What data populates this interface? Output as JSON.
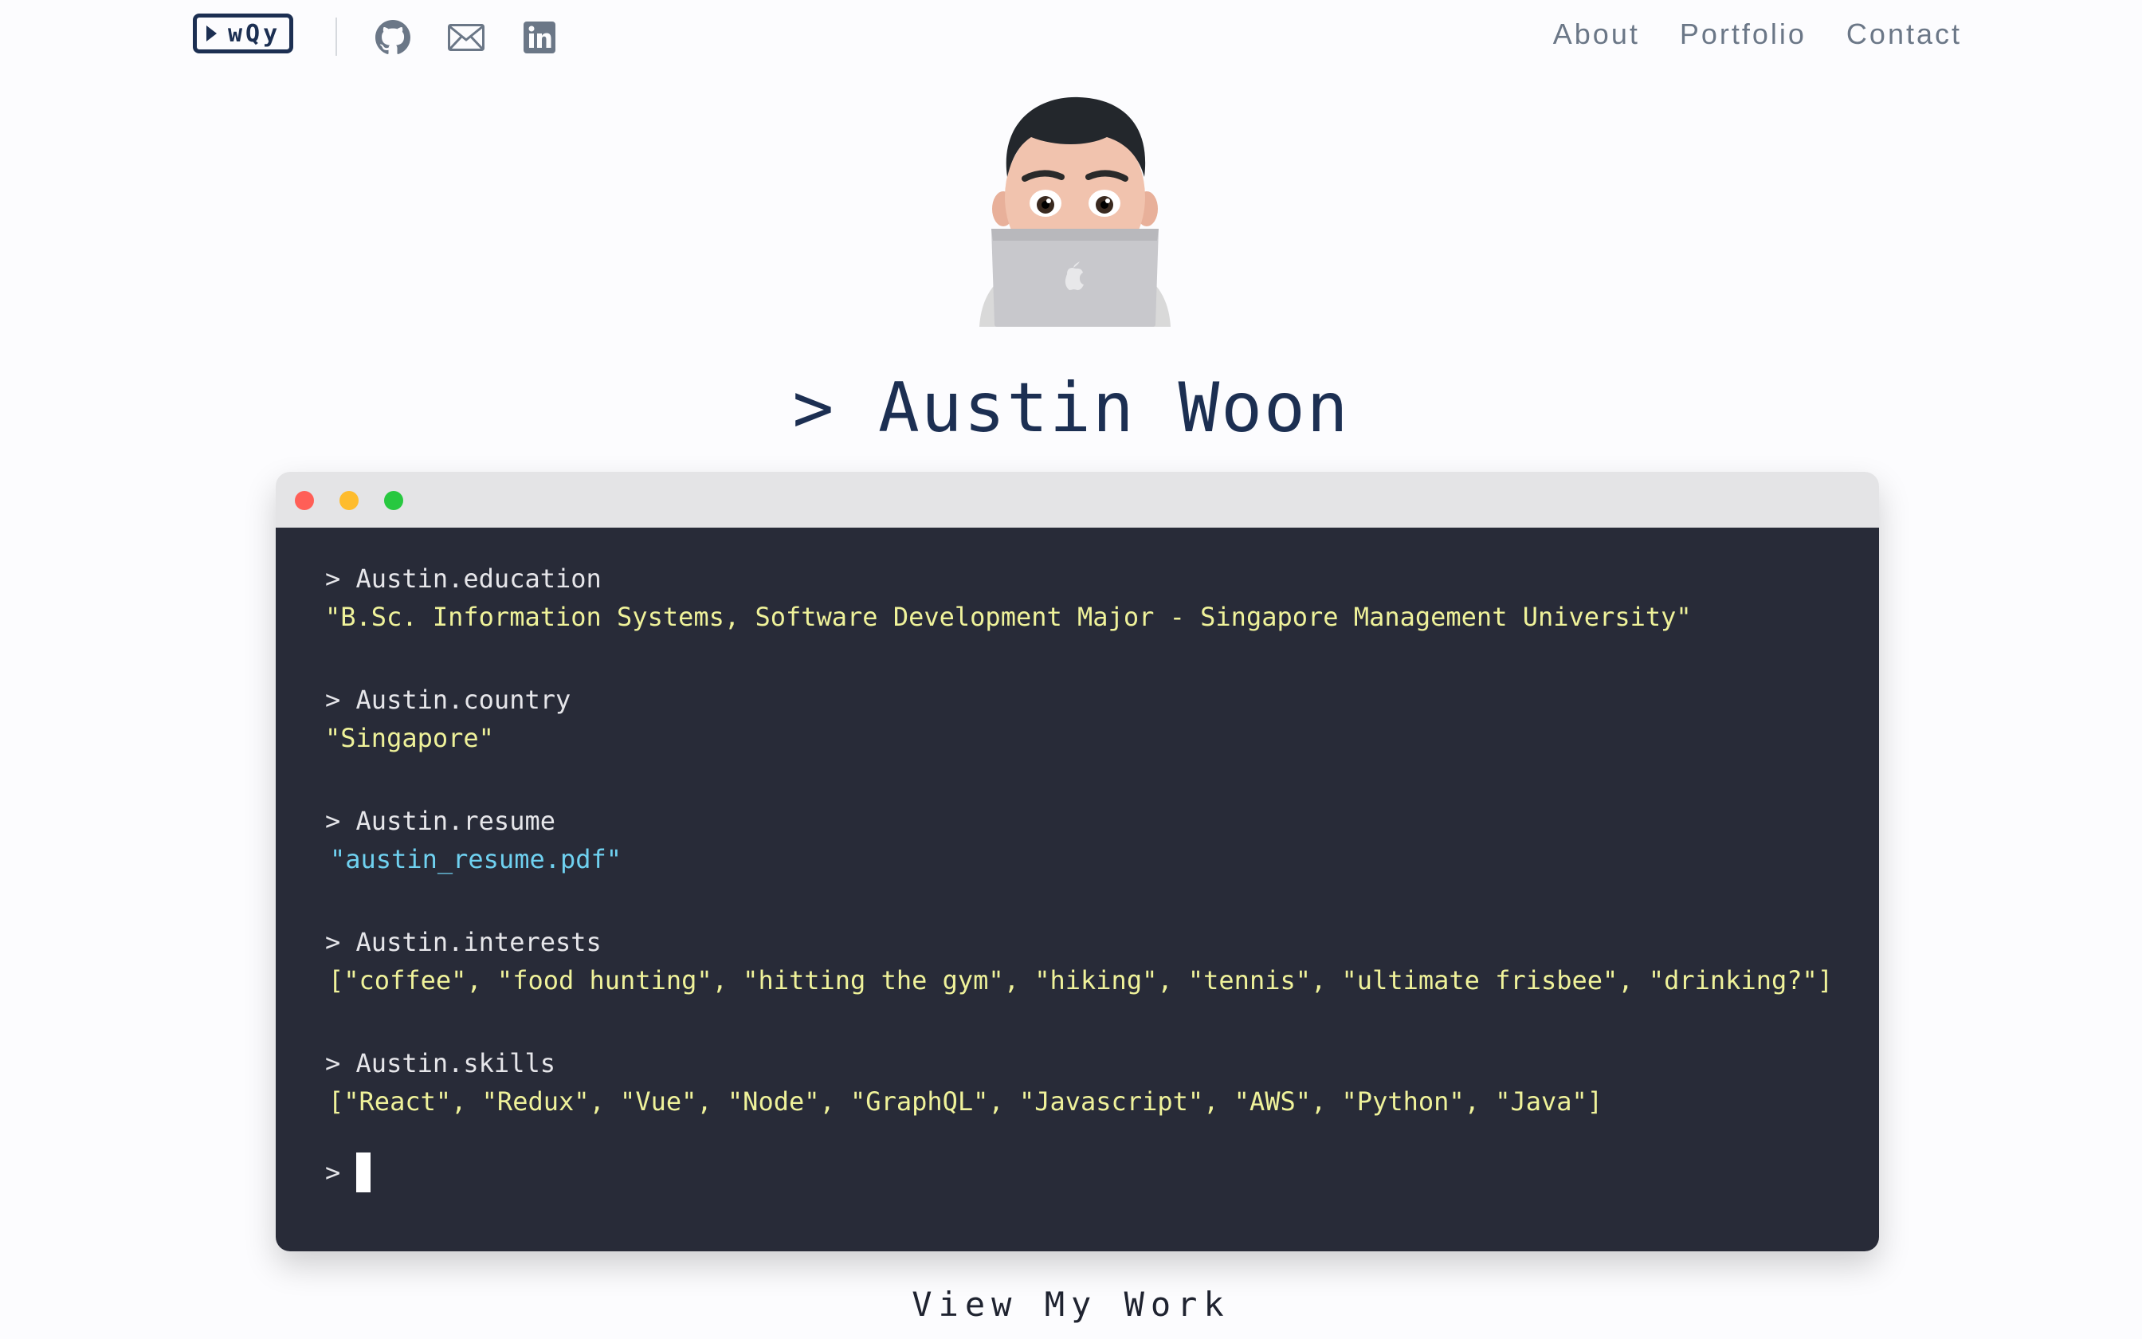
{
  "header": {
    "logo_text": "wQy",
    "social": [
      {
        "icon": "github-icon"
      },
      {
        "icon": "mail-icon"
      },
      {
        "icon": "linkedin-icon"
      }
    ],
    "nav": [
      "About",
      "Portfolio",
      "Contact"
    ]
  },
  "hero": {
    "avatar_icon": "memoji-laptop-avatar",
    "name": "> Austin Woon"
  },
  "terminal": {
    "window_controls": {
      "close_color": "#ff5f57",
      "minimize_color": "#febc2e",
      "maximize_color": "#28c840"
    },
    "entries": [
      {
        "command": "> Austin.education",
        "output": "\"B.Sc. Information Systems, Software Development Major - Singapore Management University\""
      },
      {
        "command": "> Austin.country",
        "output": "\"Singapore\""
      },
      {
        "command": "> Austin.resume",
        "output": "\"austin_resume.pdf\""
      },
      {
        "command": "> Austin.interests",
        "output": "[\"coffee\", \"food hunting\", \"hitting the gym\", \"hiking\", \"tennis\", \"ultimate frisbee\", \"drinking?\"]"
      },
      {
        "command": "> Austin.skills",
        "output": "[\"React\", \"Redux\", \"Vue\", \"Node\", \"GraphQL\", \"Javascript\", \"AWS\", \"Python\", \"Java\"]"
      }
    ],
    "prompt": ">"
  },
  "cta": {
    "view_work": "View My Work"
  },
  "colors": {
    "navy": "#1c2f52",
    "terminal_bg": "#282b38",
    "string_yellow": "#eff29a",
    "link_cyan": "#6fd1f0"
  }
}
